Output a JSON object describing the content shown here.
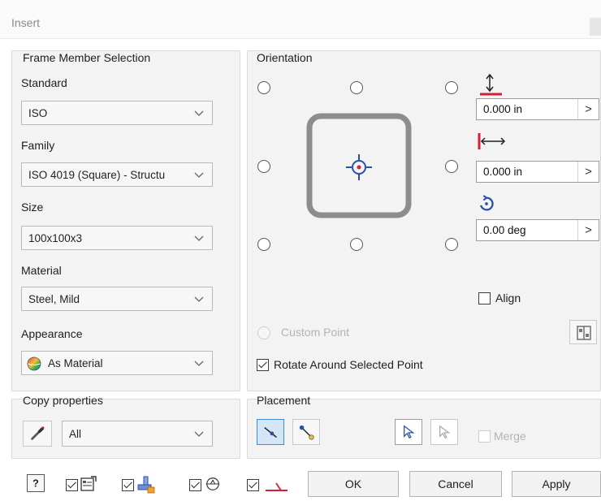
{
  "window": {
    "title": "Insert"
  },
  "frame_member": {
    "group_title": "Frame Member Selection",
    "standard": {
      "label": "Standard",
      "value": "ISO"
    },
    "family": {
      "label": "Family",
      "value": "ISO 4019 (Square) - Structu"
    },
    "size": {
      "label": "Size",
      "value": "100x100x3"
    },
    "material": {
      "label": "Material",
      "value": "Steel, Mild"
    },
    "appearance": {
      "label": "Appearance",
      "value": "As Material"
    }
  },
  "copy_properties": {
    "group_title": "Copy properties",
    "value": "All"
  },
  "orientation": {
    "group_title": "Orientation",
    "offset_vertical": "0.000 in",
    "offset_horizontal": "0.000 in",
    "rotation": "0.00 deg",
    "spin_arrow": ">",
    "align_label": "Align",
    "custom_point_label": "Custom Point",
    "rotate_around_label": "Rotate Around Selected Point"
  },
  "placement": {
    "group_title": "Placement",
    "merge_label": "Merge"
  },
  "buttons": {
    "ok": "OK",
    "cancel": "Cancel",
    "apply": "Apply"
  },
  "colors": {
    "accent_red": "#d11f3c",
    "accent_blue": "#2b4fa8",
    "active_blue": "#3c8fd6"
  }
}
